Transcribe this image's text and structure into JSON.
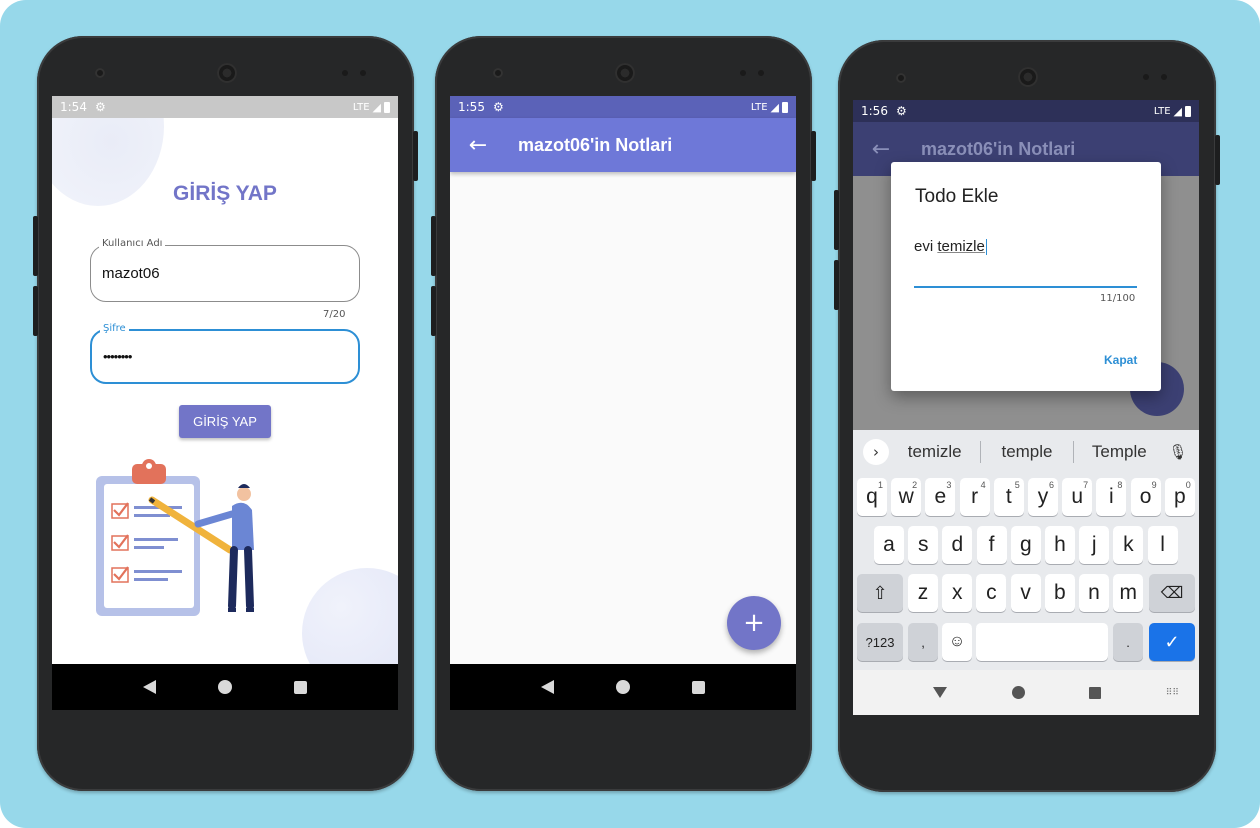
{
  "screen1": {
    "status_time": "1:54",
    "network": "LTE",
    "title": "GİRİŞ YAP",
    "username_label": "Kullanıcı Adı",
    "username_value": "mazot06",
    "username_counter": "7/20",
    "password_label": "Şifre",
    "password_value": "••••••••",
    "login_button": "GİRİŞ YAP"
  },
  "screen2": {
    "status_time": "1:55",
    "network": "LTE",
    "appbar_title": "mazot06'in Notlari",
    "fab_icon": "+"
  },
  "screen3": {
    "status_time": "1:56",
    "network": "LTE",
    "appbar_title": "mazot06'in Notlari",
    "dialog": {
      "title": "Todo Ekle",
      "input_prefix": "evi ",
      "input_word": "temizle",
      "counter": "11/100",
      "close_button": "Kapat"
    },
    "keyboard": {
      "suggestions": [
        "temizle",
        "temple",
        "Temple"
      ],
      "row1": [
        "q",
        "w",
        "e",
        "r",
        "t",
        "y",
        "u",
        "i",
        "o",
        "p"
      ],
      "row1_digits": [
        "1",
        "2",
        "3",
        "4",
        "5",
        "6",
        "7",
        "8",
        "9",
        "0"
      ],
      "row2": [
        "a",
        "s",
        "d",
        "f",
        "g",
        "h",
        "j",
        "k",
        "l"
      ],
      "row3": [
        "z",
        "x",
        "c",
        "v",
        "b",
        "n",
        "m"
      ],
      "symbols_key": "?123",
      "comma_key": ",",
      "period_key": "."
    }
  },
  "colors": {
    "background": "#97d8ea",
    "primary": "#7275c8",
    "appbar_primary": "#6e78d8",
    "appbar_dimmed": "#3c4073",
    "accent_blue": "#1a73e8"
  },
  "icons": [
    "gear-icon",
    "signal-icon",
    "battery-icon",
    "back-arrow-icon",
    "plus-icon",
    "chevron-right-icon",
    "microphone-icon",
    "shift-icon",
    "backspace-icon",
    "emoji-icon",
    "check-icon",
    "keyboard-hide-icon",
    "clipboard-illustration"
  ]
}
